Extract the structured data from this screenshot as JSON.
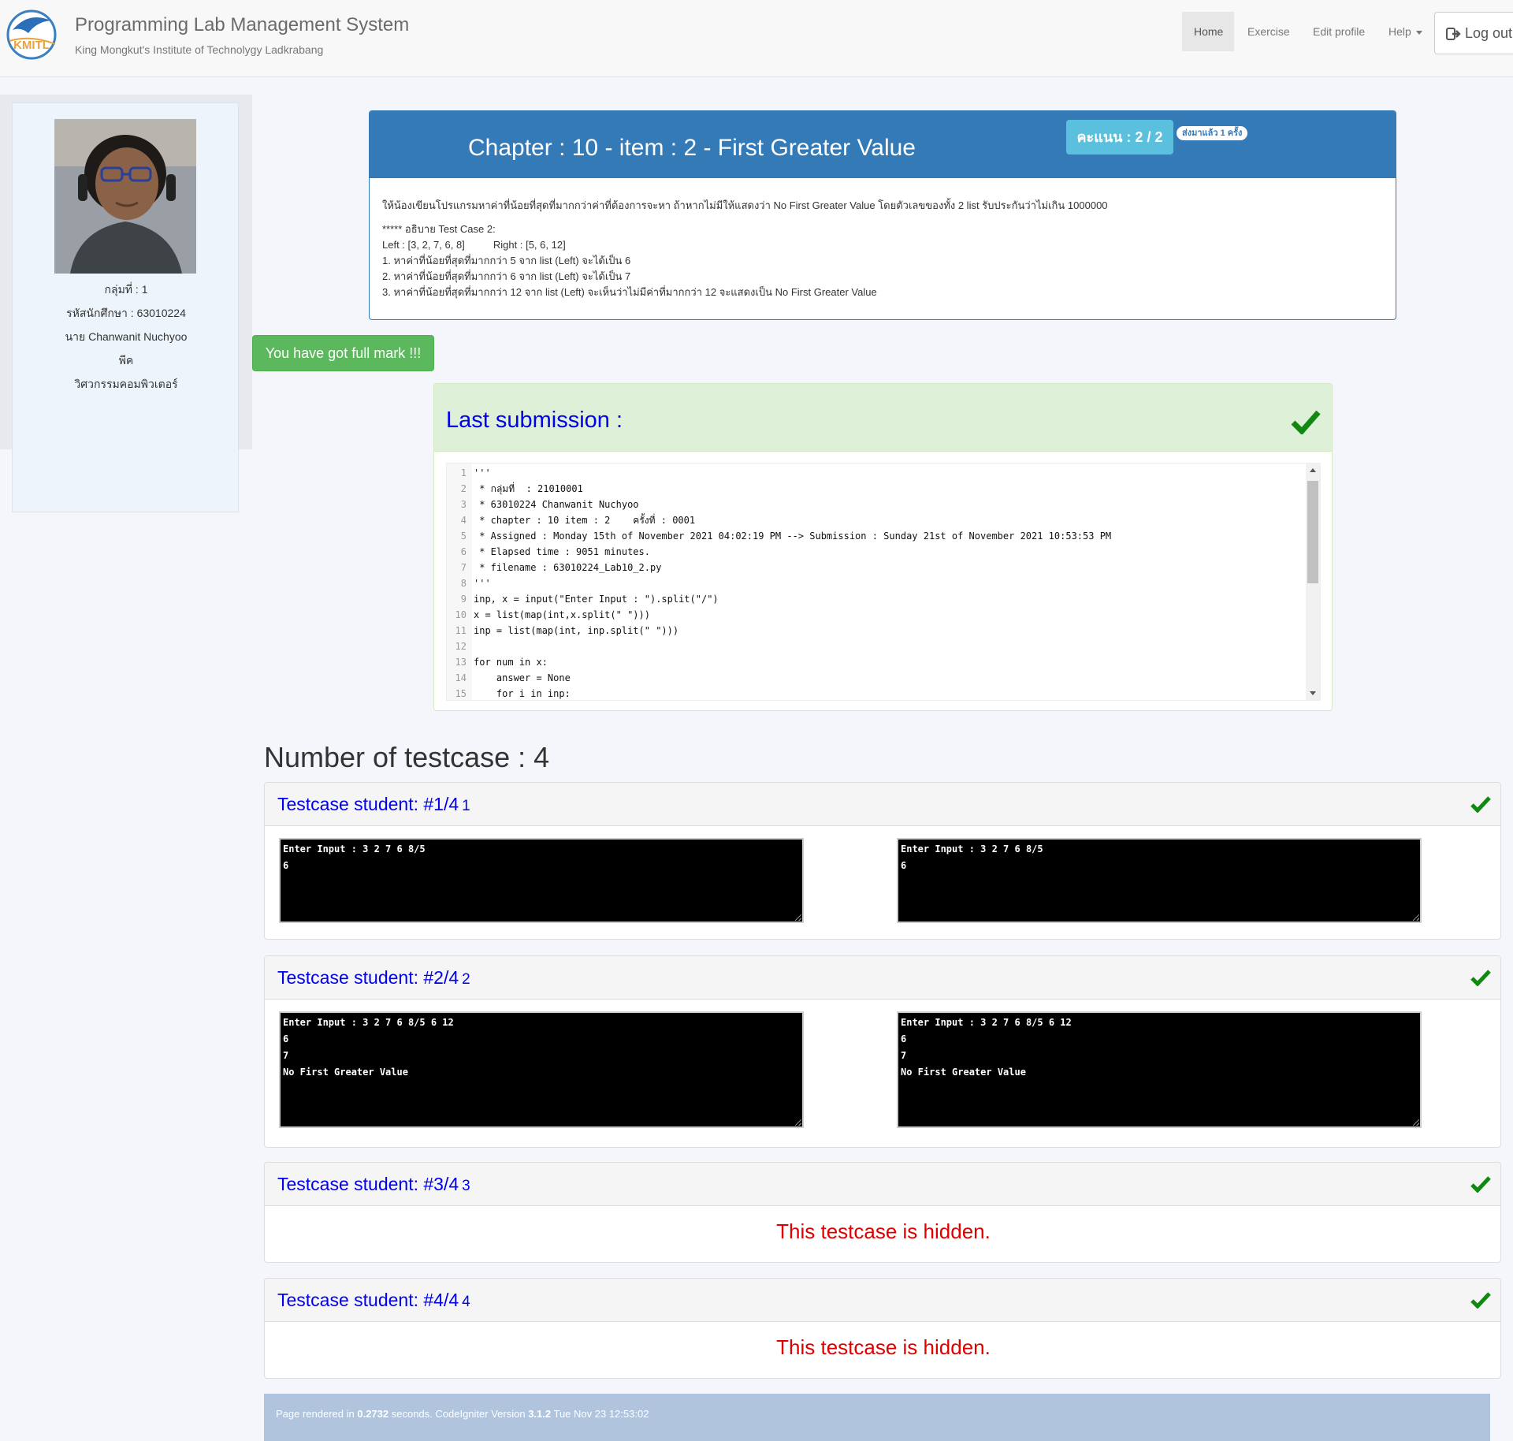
{
  "brand": {
    "logo_text": "KMITL",
    "title": "Programming Lab Management System",
    "subtitle": "King Mongkut's Institute of Technolygy Ladkrabang"
  },
  "nav": {
    "home": "Home",
    "exercise": "Exercise",
    "edit_profile": "Edit profile",
    "help": "Help",
    "logout": "Log out"
  },
  "student": {
    "group": "กลุ่มที่ : 1",
    "student_id": "รหัสนักศึกษา : 63010224",
    "name": "นาย Chanwanit Nuchyoo",
    "nickname": "พีค",
    "faculty": "วิศวกรรมคอมพิวเตอร์"
  },
  "problem": {
    "title": "Chapter : 10 - item : 2 - First Greater Value",
    "score": "คะแนน : 2 / 2",
    "submitted": "ส่งมาแล้ว 1 ครั้ง",
    "lines": [
      "ให้น้องเขียนโปรแกรมหาค่าที่น้อยที่สุดที่มากกว่าค่าที่ต้องการจะหา ถ้าหากไม่มีให้แสดงว่า No First Greater Value โดยตัวเลขของทั้ง 2 list รับประกันว่าไม่เกิน 1000000",
      "***** อธิบาย Test Case 2:",
      "Left : [3, 2, 7, 6, 8]          Right : [5, 6, 12]",
      "1. หาค่าที่น้อยที่สุดที่มากกว่า 5 จาก list (Left) จะได้เป็น 6",
      "2. หาค่าที่น้อยที่สุดที่มากกว่า 6 จาก list (Left) จะได้เป็น 7",
      "3. หาค่าที่น้อยที่สุดที่มากกว่า 12 จาก list (Left) จะเห็นว่าไม่มีค่าที่มากกว่า 12 จะแสดงเป็น No First Greater Value"
    ]
  },
  "fullmark": "You have got full mark !!!",
  "submission": {
    "title": "Last submission :",
    "code": [
      {
        "n": "1",
        "t": "'''"
      },
      {
        "n": "2",
        "t": " * กลุ่มที่  : 21010001"
      },
      {
        "n": "3",
        "t": " * 63010224 Chanwanit Nuchyoo"
      },
      {
        "n": "4",
        "t": " * chapter : 10 item : 2    ครั้งที่ : 0001"
      },
      {
        "n": "5",
        "t": " * Assigned : Monday 15th of November 2021 04:02:19 PM --> Submission : Sunday 21st of November 2021 10:53:53 PM"
      },
      {
        "n": "6",
        "t": " * Elapsed time : 9051 minutes."
      },
      {
        "n": "7",
        "t": " * filename : 63010224_Lab10_2.py"
      },
      {
        "n": "8",
        "t": "'''"
      },
      {
        "n": "9",
        "t": "inp, x = input(\"Enter Input : \").split(\"/\")"
      },
      {
        "n": "10",
        "t": "x = list(map(int,x.split(\" \")))"
      },
      {
        "n": "11",
        "t": "inp = list(map(int, inp.split(\" \")))"
      },
      {
        "n": "12",
        "t": ""
      },
      {
        "n": "13",
        "t": "for num in x:"
      },
      {
        "n": "14",
        "t": "    answer = None"
      },
      {
        "n": "15",
        "t": "    for i in inp:"
      }
    ]
  },
  "testcases": {
    "count_label": "Number of testcase : 4",
    "items": [
      {
        "title": "Testcase student: #1/4",
        "num": "1",
        "hidden": false,
        "expected": "Enter Input : 3 2 7 6 8/5\n6",
        "output": "Enter Input : 3 2 7 6 8/5\n6"
      },
      {
        "title": "Testcase student: #2/4",
        "num": "2",
        "hidden": false,
        "expected": "Enter Input : 3 2 7 6 8/5 6 12\n6\n7\nNo First Greater Value",
        "output": "Enter Input : 3 2 7 6 8/5 6 12\n6\n7\nNo First Greater Value"
      },
      {
        "title": "Testcase student: #3/4",
        "num": "3",
        "hidden": true,
        "hidden_text": "This testcase is hidden."
      },
      {
        "title": "Testcase student: #4/4",
        "num": "4",
        "hidden": true,
        "hidden_text": "This testcase is hidden."
      }
    ]
  },
  "footer": {
    "prefix": "Page rendered in ",
    "time": "0.2732",
    "middle": " seconds. CodeIgniter Version ",
    "version": "3.1.2",
    "suffix": " Tue Nov 23 12:53:02"
  },
  "colors": {
    "primary": "#337ab7",
    "success": "#5cb85c",
    "info": "#5bc0de",
    "check": "#118811",
    "hidden_text": "#e00000",
    "link": "#0000ee"
  }
}
